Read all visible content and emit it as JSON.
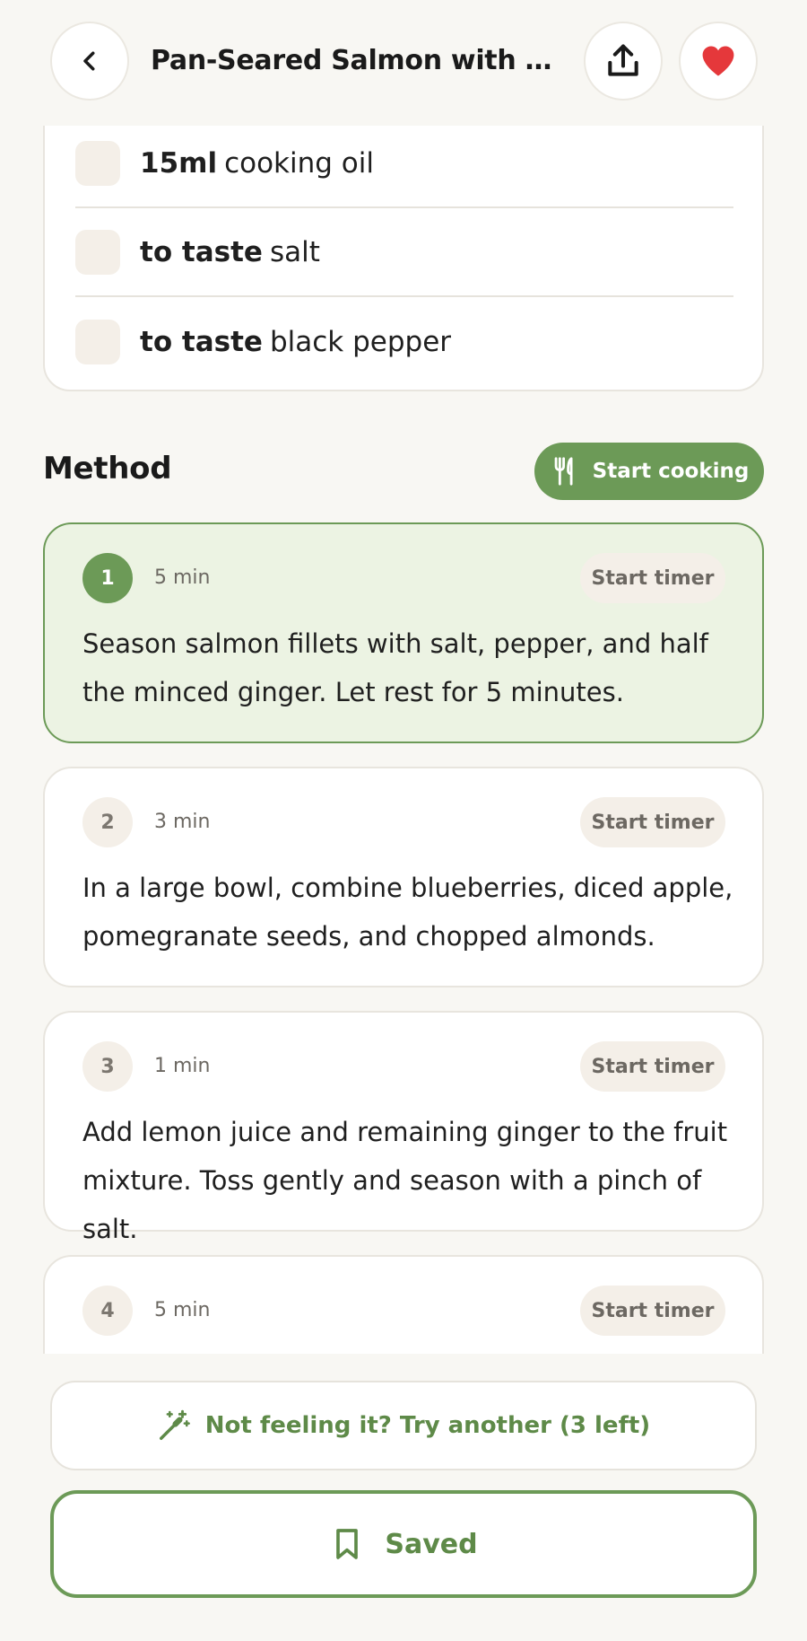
{
  "header": {
    "title": "Pan-Seared Salmon with Ginger Berry Salsa",
    "back_icon": "chevron-left-icon",
    "share_icon": "share-upload-icon",
    "favorite_icon": "heart-icon",
    "favorite_color": "#e5383b"
  },
  "ingredients": [
    {
      "qty": "15ml",
      "name": "cooking oil"
    },
    {
      "qty": "to taste",
      "name": "salt"
    },
    {
      "qty": "to taste",
      "name": "black pepper"
    }
  ],
  "method": {
    "title": "Method",
    "start_cooking_label": "Start cooking",
    "start_cooking_icon": "fork-knife-icon",
    "steps": [
      {
        "number": "1",
        "time": "5 min",
        "timer_label": "Start timer",
        "text": "Season salmon fillets with salt, pepper, and half the minced ginger. Let rest for 5 minutes.",
        "active": true
      },
      {
        "number": "2",
        "time": "3 min",
        "timer_label": "Start timer",
        "text": "In a large bowl, combine blueberries, diced apple, pomegranate seeds, and chopped almonds.",
        "active": false
      },
      {
        "number": "3",
        "time": "1 min",
        "timer_label": "Start timer",
        "text": "Add lemon juice and remaining ginger to the fruit mixture. Toss gently and season with a pinch of salt.",
        "active": false
      },
      {
        "number": "4",
        "time": "5 min",
        "timer_label": "Start timer",
        "text": "",
        "active": false
      }
    ]
  },
  "actions": {
    "try_another_label": "Not feeling it? Try another (3 left)",
    "try_another_icon": "magic-wand-icon",
    "saved_label": "Saved",
    "saved_icon": "bookmark-icon"
  },
  "colors": {
    "accent": "#6c9a57",
    "accent_text": "#5e8a48",
    "background": "#f8f7f3",
    "active_step_bg": "#ecf3e3"
  }
}
